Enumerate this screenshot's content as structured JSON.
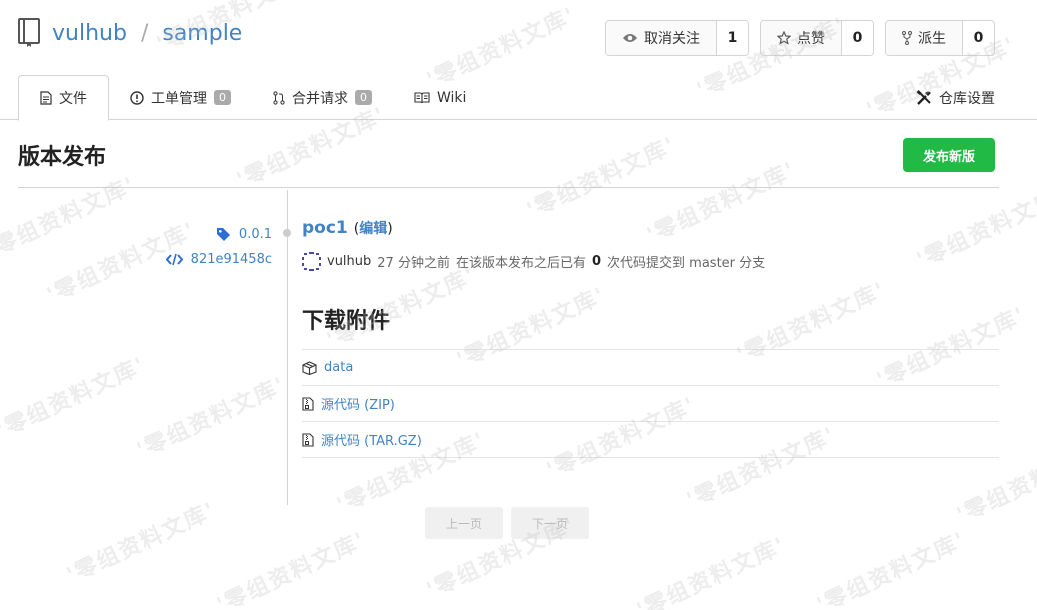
{
  "repo": {
    "owner": "vulhub",
    "name": "sample"
  },
  "actions": [
    {
      "label": "取消关注",
      "count": "1",
      "icon": "eye-icon"
    },
    {
      "label": "点赞",
      "count": "0",
      "icon": "star-icon"
    },
    {
      "label": "派生",
      "count": "0",
      "icon": "fork-icon"
    }
  ],
  "tabs": {
    "files": {
      "label": "文件"
    },
    "issues": {
      "label": "工单管理",
      "badge": "0"
    },
    "pulls": {
      "label": "合并请求",
      "badge": "0"
    },
    "wiki": {
      "label": "Wiki"
    },
    "settings": {
      "label": "仓库设置"
    }
  },
  "page": {
    "title": "版本发布",
    "new_release_label": "发布新版"
  },
  "release": {
    "tag": "0.0.1",
    "commit": "821e91458c",
    "name": "poc1",
    "edit_label": "编辑",
    "author": "vulhub",
    "time": "27 分钟之前",
    "since_text": "在该版本发布之后已有",
    "commit_count": "0",
    "tail_text": "次代码提交到 master 分支"
  },
  "downloads": {
    "title": "下载附件",
    "items": [
      {
        "label": "data",
        "icon": "package-icon"
      },
      {
        "label": "源代码 (ZIP)",
        "icon": "file-zip-icon"
      },
      {
        "label": "源代码 (TAR.GZ)",
        "icon": "file-zip-icon"
      }
    ]
  },
  "pager": {
    "prev": "上一页",
    "next": "下一页"
  },
  "watermark": {
    "text": "'零组资料文库'"
  }
}
